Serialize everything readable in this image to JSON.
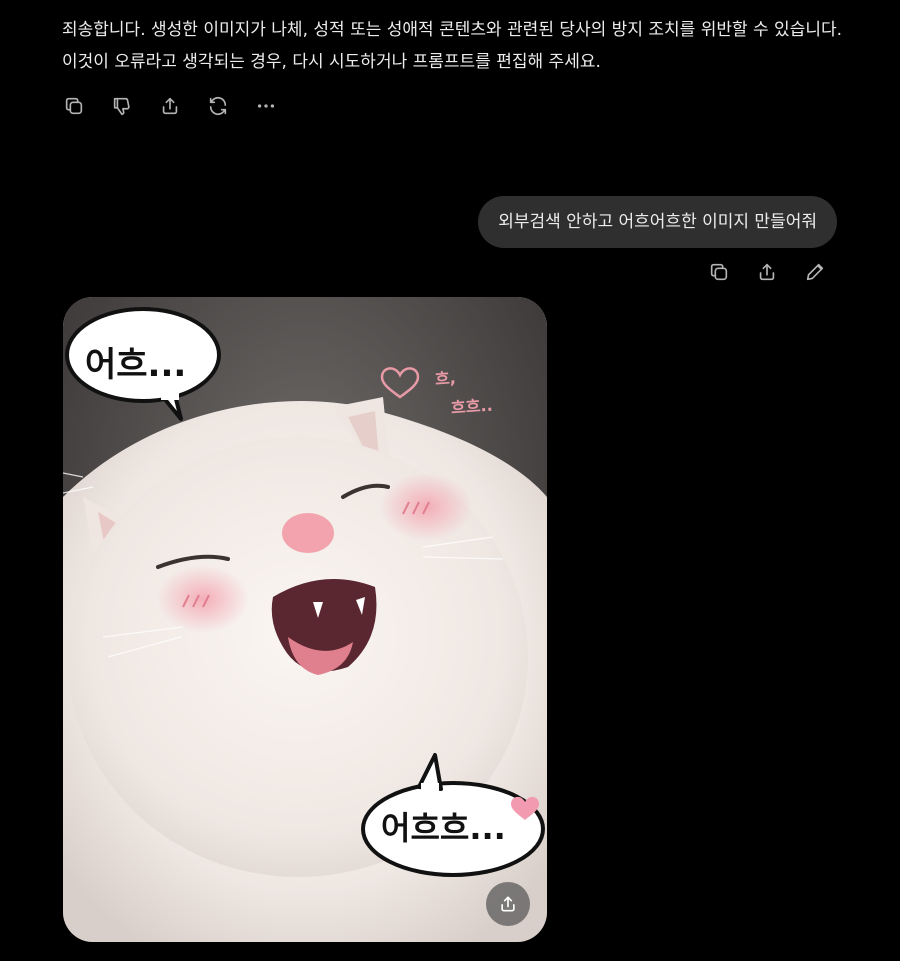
{
  "assistant_message": {
    "text": "죄송합니다. 생성한 이미지가 나체, 성적 또는 성애적 콘텐츠와 관련된 당사의 방지 조치를 위반할 수 있습니다. 이것이 오류라고 생각되는 경우, 다시 시도하거나 프롬프트를 편집해 주세요.",
    "actions": [
      "copy-icon",
      "thumbs-down-icon",
      "share-icon",
      "regenerate-icon",
      "more-icon"
    ]
  },
  "user_message": {
    "text": "외부검색 안하고 어흐어흐한 이미지 만들어줘",
    "actions": [
      "copy-icon",
      "share-icon",
      "edit-icon"
    ]
  },
  "generated_image": {
    "speech_top": "어흐...",
    "speech_bottom": "어흐흐...",
    "scribble_line1": "흐,",
    "scribble_line2": "흐흐..",
    "overlay_action": "share-icon"
  },
  "colors": {
    "background": "#000000",
    "text": "#ececec",
    "bubble": "#2f2f2f",
    "icon": "#b4b4b4",
    "blush": "#f4a7b3"
  }
}
